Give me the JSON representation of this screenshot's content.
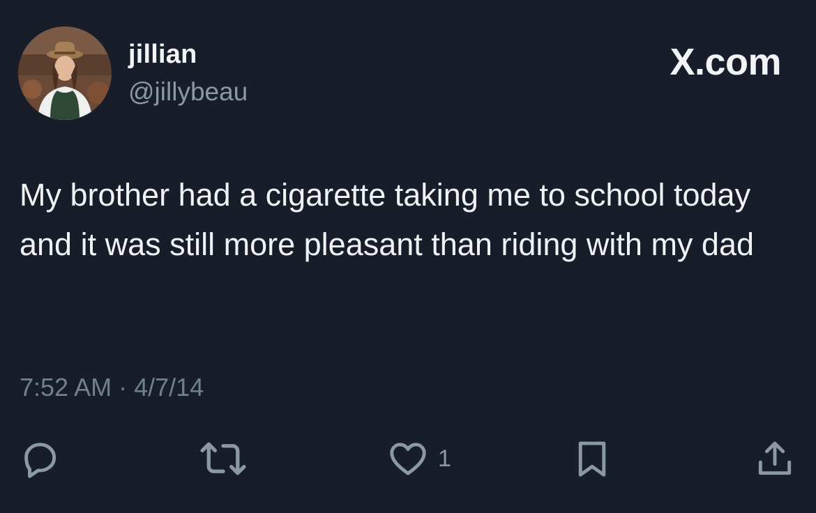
{
  "post": {
    "author": {
      "display_name": "jillian",
      "handle": "@jillybeau"
    },
    "brand": "X.com",
    "text": "My brother had a cigarette taking me to school today and it was still more pleasant than riding with my dad",
    "timestamp": "7:52 AM · 4/7/14"
  },
  "actions": {
    "reply": {
      "icon": "reply-icon"
    },
    "repost": {
      "icon": "repost-icon"
    },
    "like": {
      "icon": "heart-icon",
      "count": "1"
    },
    "bookmark": {
      "icon": "bookmark-icon"
    },
    "share": {
      "icon": "share-icon"
    }
  },
  "colors": {
    "background": "#171e29",
    "primary_text": "#f0f2f3",
    "secondary_text": "#8b98a5",
    "icon": "#8b98a5"
  }
}
